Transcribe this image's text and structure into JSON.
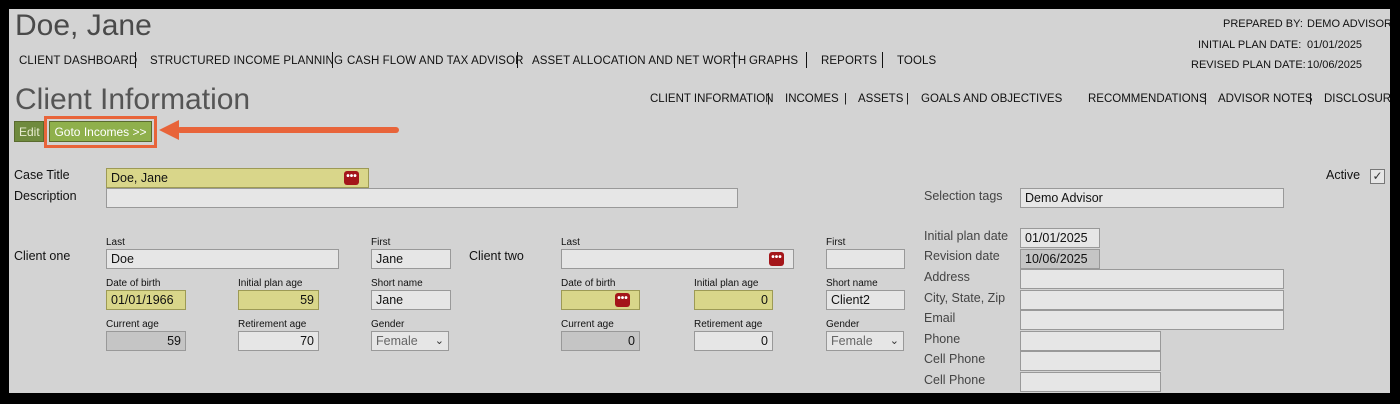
{
  "header": {
    "title": "Doe, Jane",
    "prepared_by_label": "PREPARED BY:",
    "prepared_by_value": "DEMO ADVISOR",
    "initial_plan_date_label": "INITIAL PLAN DATE:",
    "initial_plan_date_value": "01/01/2025",
    "revised_plan_date_label": "REVISED PLAN DATE:",
    "revised_plan_date_value": "10/06/2025"
  },
  "main_nav": [
    "CLIENT DASHBOARD",
    "STRUCTURED INCOME PLANNING",
    "CASH FLOW AND TAX ADVISOR",
    "ASSET ALLOCATION AND NET WORTH",
    "GRAPHS",
    "REPORTS",
    "TOOLS"
  ],
  "section": {
    "title": "Client Information",
    "sub_nav": [
      "CLIENT INFORMATION",
      "INCOMES",
      "ASSETS",
      "GOALS AND OBJECTIVES",
      "RECOMMENDATIONS",
      "ADVISOR NOTES",
      "DISCLOSURE"
    ],
    "sep": "|"
  },
  "buttons": {
    "edit": "Edit",
    "goto_incomes": "Goto Incomes >>"
  },
  "form": {
    "case_title_label": "Case Title",
    "case_title_value": "Doe, Jane",
    "description_label": "Description",
    "description_value": "",
    "active_label": "Active",
    "active_checked": "✓",
    "selection_tags_label": "Selection tags",
    "selection_tags_value": "Demo Advisor",
    "client_one": {
      "label": "Client one",
      "last_label": "Last",
      "last_value": "Doe",
      "first_label": "First",
      "first_value": "Jane",
      "dob_label": "Date of birth",
      "dob_value": "01/01/1966",
      "initial_plan_age_label": "Initial plan age",
      "initial_plan_age_value": "59",
      "short_name_label": "Short name",
      "short_name_value": "Jane",
      "current_age_label": "Current age",
      "current_age_value": "59",
      "retirement_age_label": "Retirement age",
      "retirement_age_value": "70",
      "gender_label": "Gender",
      "gender_value": "Female"
    },
    "client_two": {
      "label": "Client two",
      "last_label": "Last",
      "last_value": "",
      "first_label": "First",
      "first_value": "",
      "dob_label": "Date of birth",
      "dob_value": "",
      "initial_plan_age_label": "Initial plan age",
      "initial_plan_age_value": "0",
      "short_name_label": "Short name",
      "short_name_value": "Client2",
      "current_age_label": "Current age",
      "current_age_value": "0",
      "retirement_age_label": "Retirement age",
      "retirement_age_value": "0",
      "gender_label": "Gender",
      "gender_value": "Female"
    },
    "plan": {
      "initial_plan_date_label": "Initial plan date",
      "initial_plan_date_value": "01/01/2025",
      "revision_date_label": "Revision date",
      "revision_date_value": "10/06/2025",
      "address_label": "Address",
      "address_value": "",
      "city_label": "City, State, Zip",
      "city_value": "",
      "email_label": "Email",
      "email_value": "",
      "phone_label": "Phone",
      "phone_value": "",
      "cell_phone_label": "Cell Phone",
      "cell_phone_value": "",
      "cell_phone2_label": "Cell Phone",
      "cell_phone2_value": ""
    }
  },
  "icons": {
    "dots": "•••",
    "chevron": "⌄"
  },
  "colors": {
    "accent_green": "#8fb04c",
    "highlight_orange": "#e8643a",
    "required_yellow": "#d9d68a",
    "dots_red": "#a4161a"
  }
}
